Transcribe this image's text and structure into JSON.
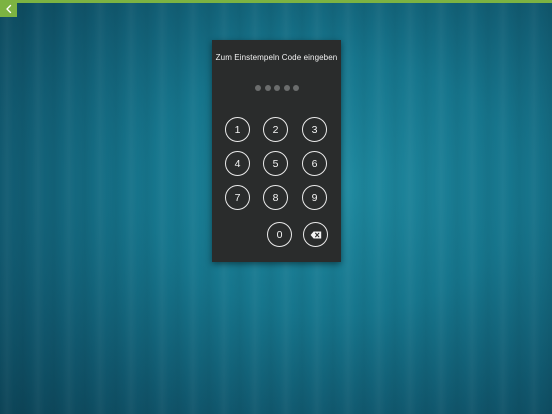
{
  "colors": {
    "accent": "#7cb342",
    "panel": "#2a2c2c",
    "dot_empty": "#6b6d6d",
    "key_border": "#eaeaea"
  },
  "topbar": {
    "back_icon": "chevron-left-icon"
  },
  "pin_pad": {
    "title": "Zum Einstempeln Code eingeben",
    "entered_digits": 0,
    "code_length": 5,
    "keys": {
      "k1": "1",
      "k2": "2",
      "k3": "3",
      "k4": "4",
      "k5": "5",
      "k6": "6",
      "k7": "7",
      "k8": "8",
      "k9": "9",
      "k0": "0"
    },
    "backspace_icon": "backspace-icon"
  }
}
